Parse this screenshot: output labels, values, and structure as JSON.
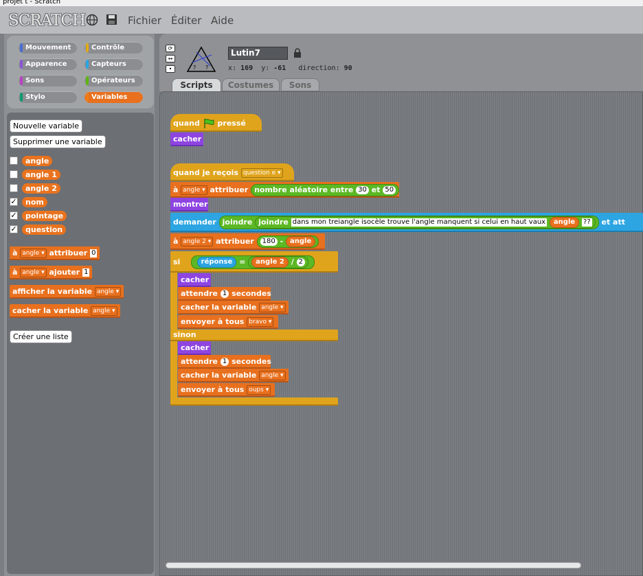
{
  "window": {
    "title": "projet t - Scratch"
  },
  "menu": {
    "logo": "SCRATCH",
    "file": "Fichier",
    "edit": "Éditer",
    "help": "Aide"
  },
  "categories": [
    {
      "label": "Mouvement",
      "color": "#4a6cd4"
    },
    {
      "label": "Contrôle",
      "color": "#e1a91a"
    },
    {
      "label": "Apparence",
      "color": "#8a55d7"
    },
    {
      "label": "Capteurs",
      "color": "#2ca5e2"
    },
    {
      "label": "Sons",
      "color": "#bb42c3"
    },
    {
      "label": "Opérateurs",
      "color": "#5cb712"
    },
    {
      "label": "Stylo",
      "color": "#0e9a6c"
    },
    {
      "label": "Variables",
      "color": "#ee7d16"
    }
  ],
  "palette": {
    "new_var": "Nouvelle variable",
    "delete_var": "Supprimer une variable",
    "variables": [
      {
        "name": "angle",
        "checked": ""
      },
      {
        "name": "angle 1",
        "checked": ""
      },
      {
        "name": "angle 2",
        "checked": ""
      },
      {
        "name": "nom",
        "checked": "✓"
      },
      {
        "name": "pointage",
        "checked": "✓"
      },
      {
        "name": "question",
        "checked": "✓"
      }
    ],
    "set_block": {
      "a": "à",
      "var": "angle",
      "verb": "attribuer",
      "value": "0"
    },
    "change_block": {
      "a": "à",
      "var": "angle",
      "verb": "ajouter",
      "value": "1"
    },
    "show_block": {
      "label": "afficher la variable",
      "var": "angle"
    },
    "hide_block": {
      "label": "cacher la variable",
      "var": "angle"
    },
    "new_list": "Créer une liste"
  },
  "sprite": {
    "name": "Lutin7",
    "x_label": "x:",
    "x": "169",
    "y_label": "y:",
    "y": "-61",
    "dir_label": "direction:",
    "dir": "90"
  },
  "tabs": {
    "scripts": "Scripts",
    "costumes": "Costumes",
    "sounds": "Sons"
  },
  "script1": {
    "hat_a": "quand",
    "hat_b": "pressé",
    "hide": "cacher"
  },
  "script2": {
    "hat": "quand je reçois",
    "hat_msg": "question e",
    "set_a": "à",
    "set_var": "angle",
    "set_verb": "attribuer",
    "random": "nombre aléatoire entre",
    "rand_min": "30",
    "rand_and": "et",
    "rand_max": "50",
    "show": "montrer",
    "ask": "demander",
    "join1": "joindre",
    "join2": "joindre",
    "question_text": "dans mon treiangle isocèle trouve l'angle manquent si celui en haut vaux",
    "ask_var": "angle",
    "ask_q": "??",
    "ask_tail": "et att",
    "set2_a": "à",
    "set2_var": "angle 2",
    "set2_verb": "attribuer",
    "set2_num": "180",
    "set2_minus": "-",
    "set2_rvar": "angle",
    "if": "si",
    "answer": "réponse",
    "eq": "=",
    "div_var": "angle 2",
    "div": "/",
    "div_num": "2",
    "t_hide": "cacher",
    "t_wait": "attendre",
    "t_wait_n": "1",
    "t_wait_unit": "secondes",
    "t_hidevar": "cacher la variable",
    "t_hidevar_v": "angle",
    "t_send": "envoyer à tous",
    "t_send_msg": "bravo",
    "else": "sinon",
    "e_hide": "cacher",
    "e_wait": "attendre",
    "e_wait_n": "1",
    "e_wait_unit": "secondes",
    "e_hidevar": "cacher la variable",
    "e_hidevar_v": "angle",
    "e_send": "envoyer à tous",
    "e_send_msg": "oups"
  }
}
